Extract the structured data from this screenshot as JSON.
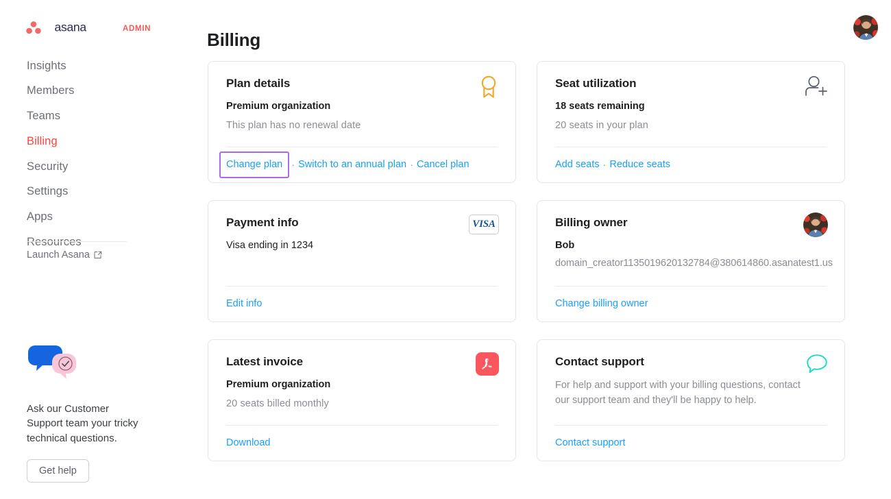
{
  "brand": {
    "name": "asana",
    "suffix": "ADMIN",
    "logo_icon": "asana-logo-icon",
    "dot_color": "#f06a6a",
    "wordmark_color": "#2b2b4e",
    "admin_color": "#f25a5a"
  },
  "header": {
    "title": "Billing",
    "avatar_icon": "user-avatar"
  },
  "sidebar": {
    "items": [
      {
        "label": "Insights",
        "active": false
      },
      {
        "label": "Members",
        "active": false
      },
      {
        "label": "Teams",
        "active": false
      },
      {
        "label": "Billing",
        "active": true
      },
      {
        "label": "Security",
        "active": false
      },
      {
        "label": "Settings",
        "active": false
      },
      {
        "label": "Apps",
        "active": false
      },
      {
        "label": "Resources",
        "active": false
      }
    ],
    "launch": {
      "label": "Launch Asana",
      "icon": "external-link-icon"
    },
    "support": {
      "icon": "chat-bubbles-icon",
      "text": "Ask our Customer Support team your tricky technical questions.",
      "button_label": "Get help"
    }
  },
  "cards": {
    "plan_details": {
      "title": "Plan details",
      "icon": "award-ribbon-icon",
      "icon_color": "#f5a623",
      "plan_name": "Premium organization",
      "renewal": "This plan has no renewal date",
      "links": [
        "Change plan",
        "Switch to an annual plan",
        "Cancel plan"
      ],
      "focused_link": "Change plan",
      "focus_color": "#ac6ae5"
    },
    "seat_utilization": {
      "title": "Seat utilization",
      "icon": "person-add-icon",
      "icon_color": "#565f6b",
      "remaining": "18 seats remaining",
      "total": "20 seats in your plan",
      "links": [
        "Add seats",
        "Reduce seats"
      ]
    },
    "payment_info": {
      "title": "Payment info",
      "icon": "visa-card-icon",
      "card_brand": "VISA",
      "card_text": "Visa ending in 1234",
      "links": [
        "Edit info"
      ]
    },
    "billing_owner": {
      "title": "Billing owner",
      "icon": "owner-avatar",
      "name": "Bob",
      "email": "domain_creator1135019620132784@380614860.asanatest1.us",
      "links": [
        "Change billing owner"
      ]
    },
    "latest_invoice": {
      "title": "Latest invoice",
      "icon": "pdf-file-icon",
      "icon_color": "#f9565e",
      "plan_name": "Premium organization",
      "seats": "20 seats billed monthly",
      "links": [
        "Download"
      ]
    },
    "contact_support": {
      "title": "Contact support",
      "icon": "speech-bubble-icon",
      "icon_color": "#16dcc0",
      "body": "For help and support with your billing questions, contact our support team and they'll be happy to help.",
      "links": [
        "Contact support"
      ]
    }
  },
  "theme": {
    "link_color": "#18a0fb",
    "active_nav_color": "#f9463a",
    "muted_text": "#8a8e94"
  }
}
